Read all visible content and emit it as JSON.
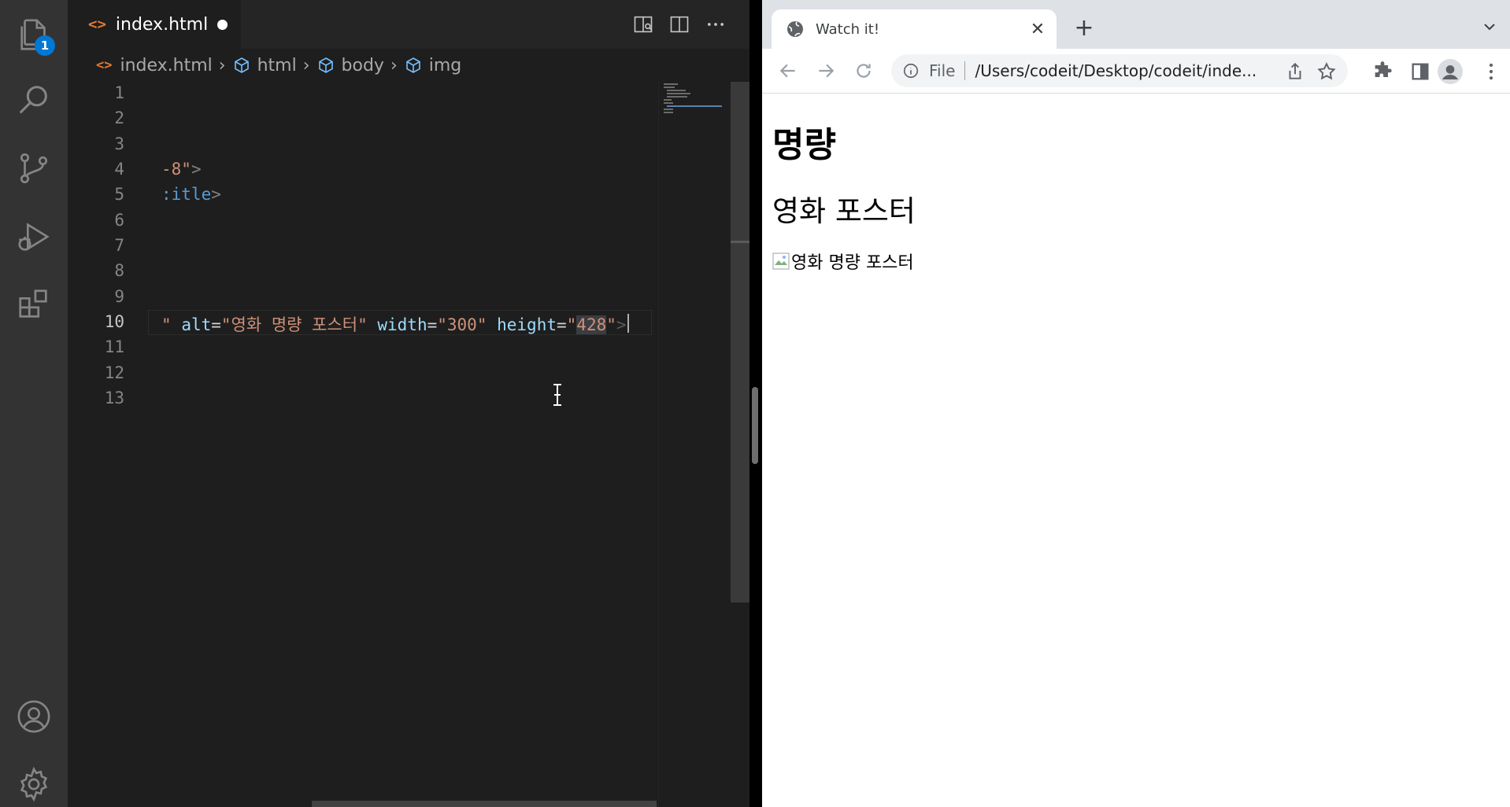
{
  "activity_bar": {
    "explorer_badge": "1"
  },
  "editor": {
    "tab_label": "index.html",
    "tab_icon": "<>",
    "breadcrumb": {
      "file": "index.html",
      "items": [
        "html",
        "body",
        "img"
      ]
    },
    "line_numbers": [
      "1",
      "2",
      "3",
      "4",
      "5",
      "6",
      "7",
      "8",
      "9",
      "10",
      "11",
      "12",
      "13"
    ],
    "code_lines": {
      "l4": {
        "str": "-8\"",
        "tag_close": ">"
      },
      "l5": {
        "name": ":itle",
        "tag_close": ">"
      },
      "l10": {
        "lead": "\"",
        "attr_alt": "alt",
        "val_alt": "\"영화 명량 포스터\"",
        "attr_width": "width",
        "val_width": "\"300\"",
        "attr_height": "height",
        "val_height_open": "\"",
        "val_height": "428",
        "val_height_close": "\"",
        "tag_close": ">"
      }
    }
  },
  "browser": {
    "tab_title": "Watch it!",
    "omnibox": {
      "scheme": "File",
      "url": "/Users/codeit/Desktop/codeit/inde..."
    },
    "page": {
      "h1": "명량",
      "h2": "영화 포스터",
      "img_alt": "영화 명량 포스터"
    }
  },
  "colors": {
    "accent_badge": "#0078d4",
    "html_file_icon": "#e37933",
    "string": "#ce9178",
    "attribute": "#9cdcfe",
    "tag_name": "#569cd6"
  }
}
